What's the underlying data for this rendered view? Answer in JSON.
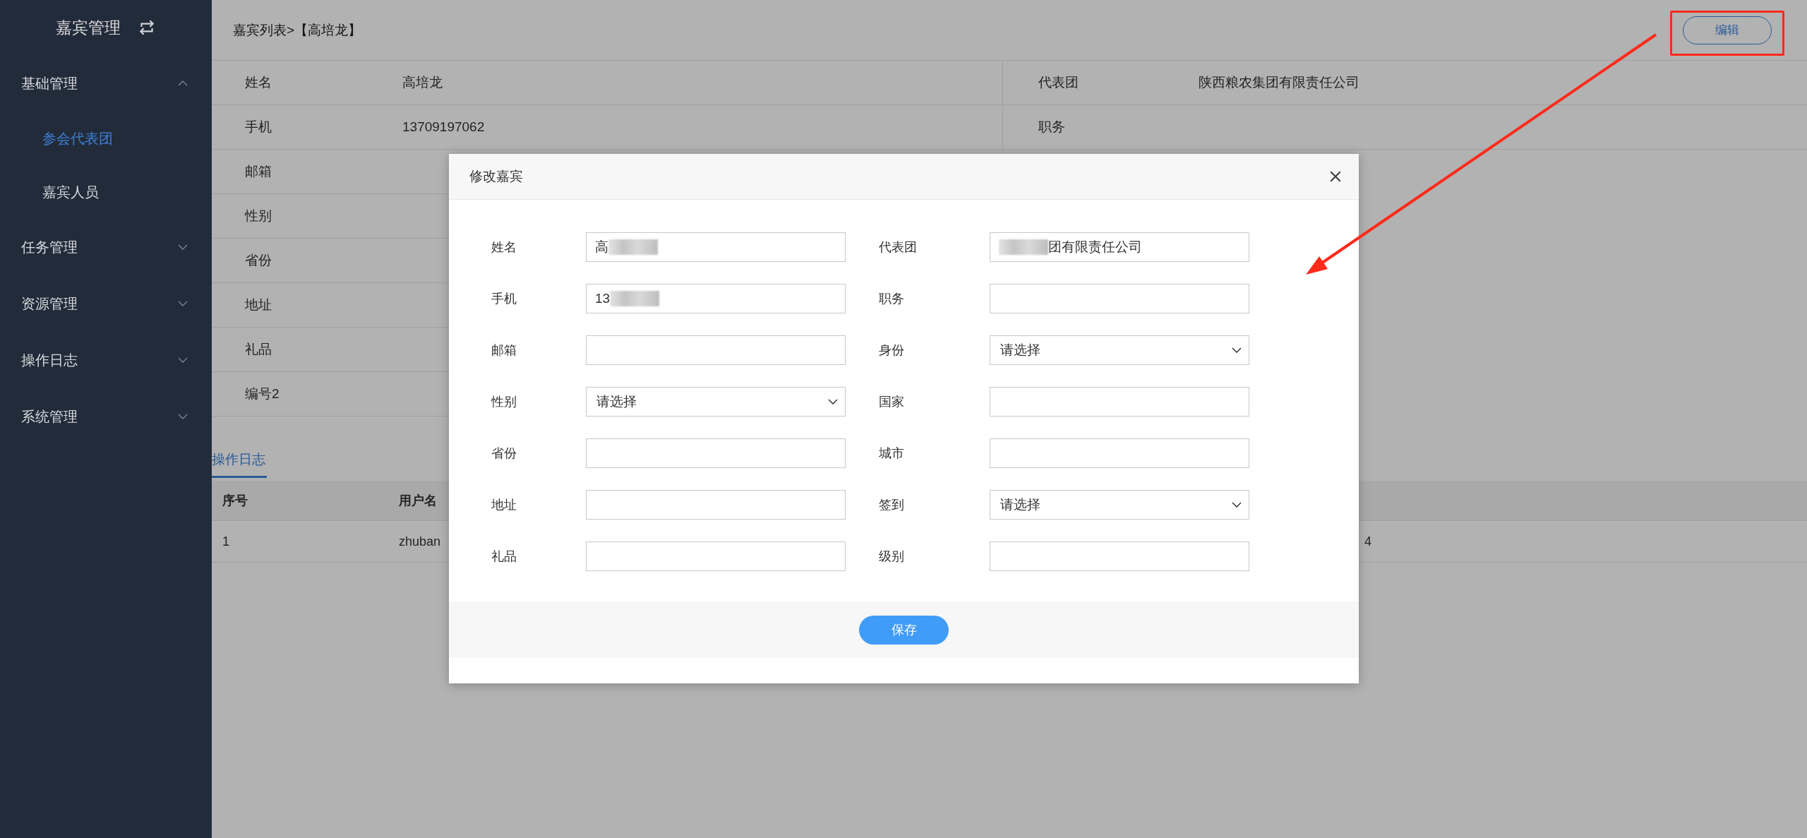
{
  "sidebar": {
    "title": "嘉宾管理",
    "items": [
      {
        "label": "基础管理",
        "expanded": true,
        "children": [
          {
            "label": "参会代表团",
            "selected": true
          },
          {
            "label": "嘉宾人员",
            "selected": false
          }
        ]
      },
      {
        "label": "任务管理",
        "expanded": false
      },
      {
        "label": "资源管理",
        "expanded": false
      },
      {
        "label": "操作日志",
        "expanded": false
      },
      {
        "label": "系统管理",
        "expanded": false
      }
    ]
  },
  "header": {
    "breadcrumb": "嘉宾列表>【高培龙】",
    "edit_button": "编辑"
  },
  "details": {
    "left": [
      {
        "label": "姓名",
        "value": "高培龙"
      },
      {
        "label": "手机",
        "value": "13709197062"
      },
      {
        "label": "邮箱"
      },
      {
        "label": "性别"
      },
      {
        "label": "省份"
      },
      {
        "label": "地址"
      },
      {
        "label": "礼品"
      },
      {
        "label": "编号2"
      }
    ],
    "right": [
      {
        "label": "代表团",
        "value": "陕西粮农集团有限责任公司"
      },
      {
        "label": "职务"
      }
    ]
  },
  "tabs": [
    {
      "label": "操作日志",
      "selected": true
    }
  ],
  "log_table": {
    "columns": [
      "序号",
      "用户名"
    ],
    "rows": [
      {
        "cells": [
          "1",
          "zhuban",
          "4"
        ]
      }
    ]
  },
  "modal": {
    "title": "修改嘉宾",
    "fields": [
      {
        "label": "姓名",
        "kind": "text",
        "value": "高",
        "blurred_end": true
      },
      {
        "label": "代表团",
        "kind": "text",
        "value": "团有限责任公司",
        "blurred_start": true
      },
      {
        "label": "手机",
        "kind": "text",
        "value": "13",
        "blurred_end": true
      },
      {
        "label": "职务",
        "kind": "text"
      },
      {
        "label": "邮箱",
        "kind": "text"
      },
      {
        "label": "身份",
        "kind": "select",
        "value": "请选择"
      },
      {
        "label": "性别",
        "kind": "select",
        "value": "请选择"
      },
      {
        "label": "国家",
        "kind": "text"
      },
      {
        "label": "省份",
        "kind": "text"
      },
      {
        "label": "城市",
        "kind": "text"
      },
      {
        "label": "地址",
        "kind": "text"
      },
      {
        "label": "签到",
        "kind": "select",
        "value": "请选择"
      },
      {
        "label": "礼品",
        "kind": "text"
      },
      {
        "label": "级别",
        "kind": "text"
      }
    ],
    "save_button": "保存"
  }
}
